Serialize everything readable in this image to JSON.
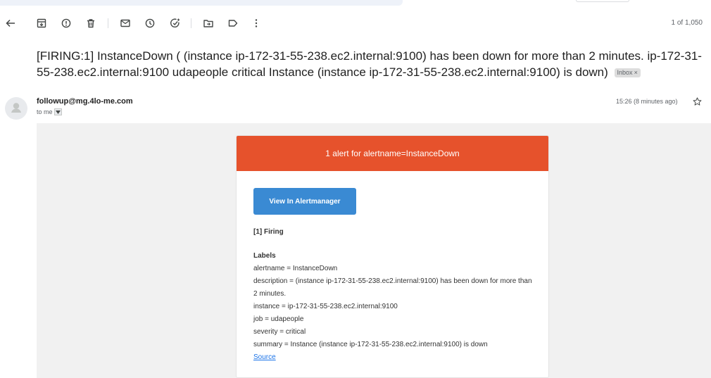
{
  "toolbar": {
    "icons": [
      "back-arrow-icon",
      "archive-icon",
      "report-spam-icon",
      "delete-icon",
      "mark-unread-icon",
      "snooze-icon",
      "add-task-icon",
      "move-to-icon",
      "label-icon",
      "more-vert-icon"
    ],
    "page_count": "1 of 1,050"
  },
  "email": {
    "subject": "[FIRING:1] InstanceDown ( (instance ip-172-31-55-238.ec2.internal:9100) has been down for more than 2 minutes. ip-172-31-55-238.ec2.internal:9100 udapeople critical Instance (instance ip-172-31-55-238.ec2.internal:9100) is down)",
    "label_chip": "Inbox",
    "label_chip_close": "×",
    "sender": "followup@mg.4lo-me.com",
    "to": "to me",
    "time": "15:26 (8 minutes ago)"
  },
  "body": {
    "header": "1 alert for alertname=InstanceDown",
    "header_color": "#e6522c",
    "button_label": "View In Alertmanager",
    "button_color": "#3a8ad3",
    "firing": "[1] Firing",
    "labels_title": "Labels",
    "labels": [
      "alertname = InstanceDown",
      "description = (instance ip-172-31-55-238.ec2.internal:9100) has been down for more than 2 minutes.",
      "instance = ip-172-31-55-238.ec2.internal:9100",
      "job = udapeople",
      "severity = critical",
      "summary = Instance (instance ip-172-31-55-238.ec2.internal:9100) is down"
    ],
    "source_link": "Source"
  }
}
